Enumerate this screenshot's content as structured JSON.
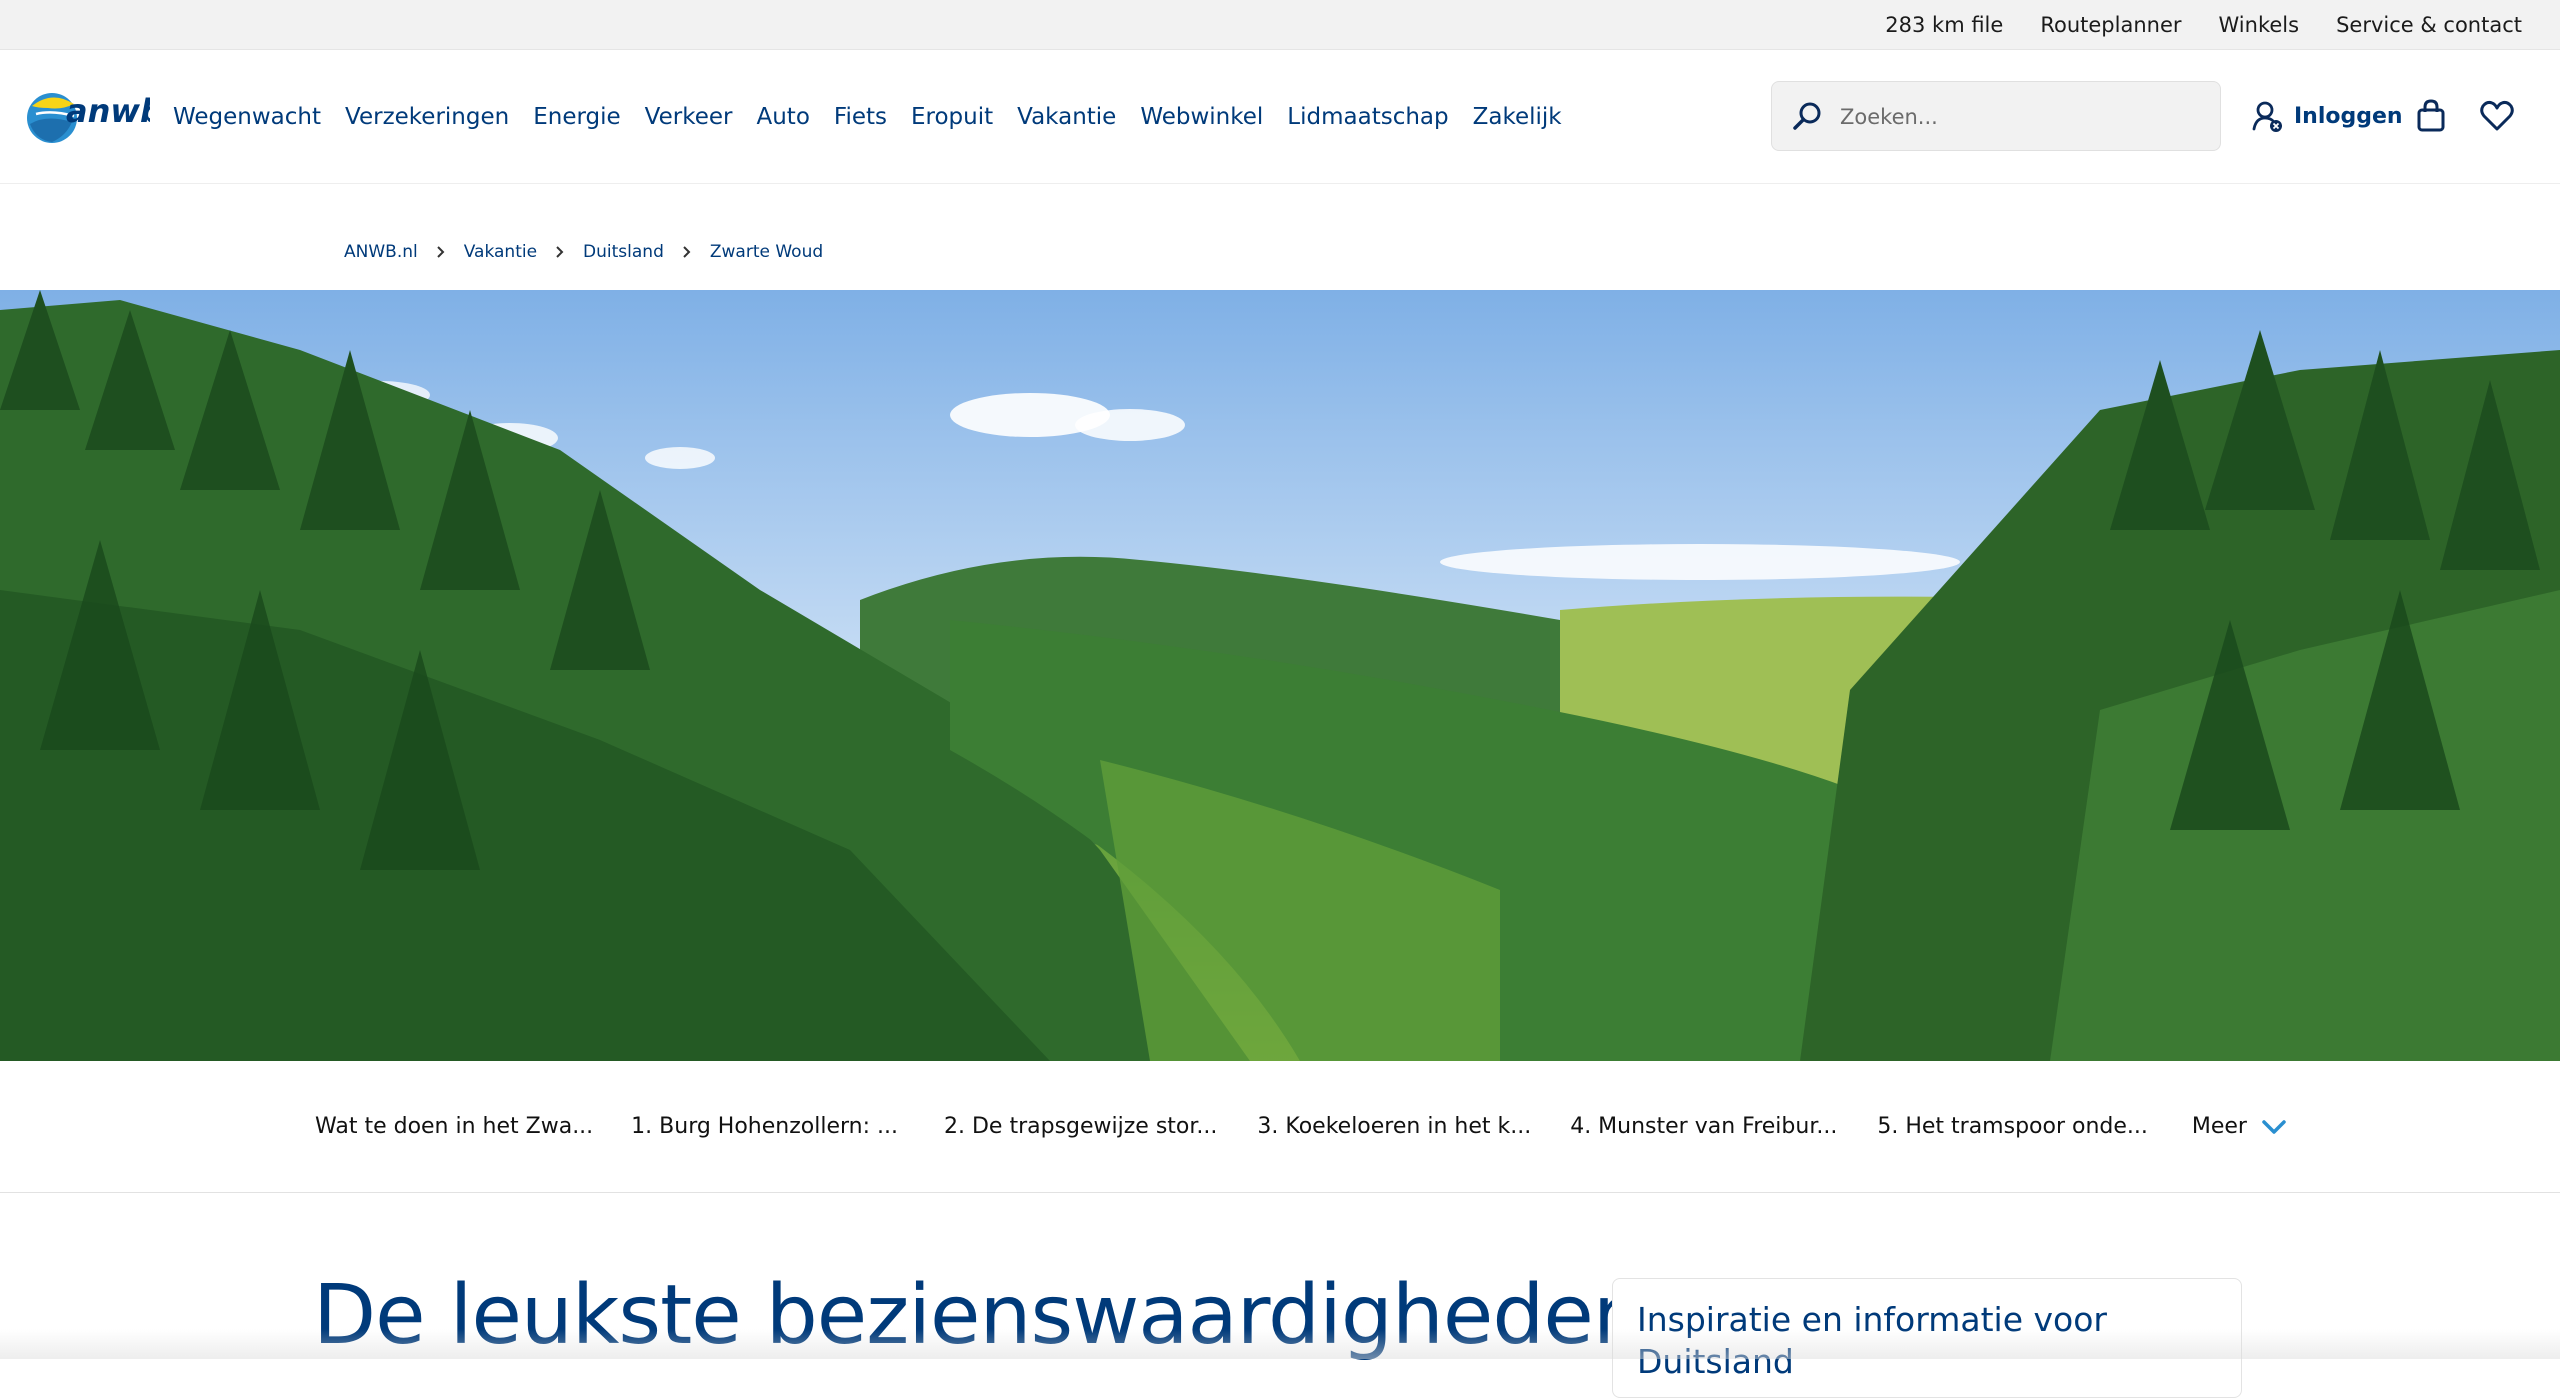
{
  "utility": {
    "links": [
      "283 km file",
      "Routeplanner",
      "Winkels",
      "Service & contact"
    ]
  },
  "header": {
    "logo_text": "anwb",
    "nav": [
      "Wegenwacht",
      "Verzekeringen",
      "Energie",
      "Verkeer",
      "Auto",
      "Fiets",
      "Eropuit",
      "Vakantie",
      "Webwinkel",
      "Lidmaatschap",
      "Zakelijk"
    ],
    "search_placeholder": "Zoeken...",
    "login_label": "Inloggen"
  },
  "breadcrumb": [
    "ANWB.nl",
    "Vakantie",
    "Duitsland",
    "Zwarte Woud"
  ],
  "anchor_nav": {
    "items": [
      "Wat te doen in het Zwa...",
      "1. Burg Hohenzollern: ...",
      "2. De trapsgewijze stor...",
      "3. Koekeloeren in het k...",
      "4. Munster van Freibur...",
      "5. Het tramspoor onde..."
    ],
    "more_label": "Meer"
  },
  "main": {
    "title": "De leukste bezienswaardigheden",
    "side_card_title": "Inspiratie en informatie voor Duitsland"
  },
  "colors": {
    "brand_blue": "#003a7a",
    "accent_blue": "#2a8fd0",
    "logo_yellow": "#f7d417"
  }
}
